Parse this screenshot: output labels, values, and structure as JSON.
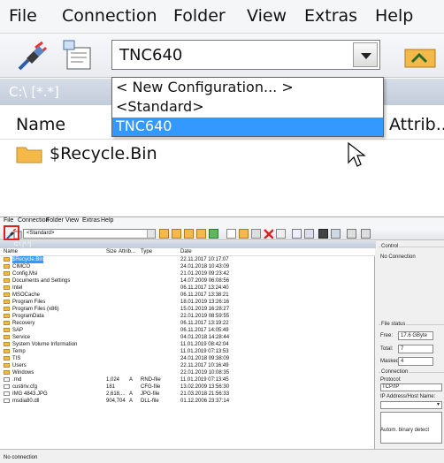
{
  "zoom": {
    "menu": [
      "File",
      "Connection",
      "Folder",
      "View",
      "Extras",
      "Help"
    ],
    "combo_value": "TNC640",
    "path": "C:\\ [*.*]",
    "col_name": "Name",
    "col_attrib": "Attrib...",
    "first_row": "$Recycle.Bin",
    "dropdown_options": [
      "< New Configuration... >",
      "<Standard>",
      "TNC640"
    ],
    "dropdown_selected_index": 2
  },
  "app": {
    "menu": [
      "File",
      "Connection",
      "Folder",
      "View",
      "Extras",
      "Help"
    ],
    "combo_value": "<Standard>",
    "path": "C:\\ [*.*]",
    "columns": [
      "Name",
      "Size",
      "Attrib...",
      "Type",
      "Date"
    ],
    "rows": [
      {
        "name": "$Recycle.Bin",
        "size": "",
        "attr": "",
        "type": "",
        "date": "22.11.2017 10:17:07",
        "kind": "folder",
        "selected": true
      },
      {
        "name": "CIMCO",
        "size": "",
        "attr": "",
        "type": "",
        "date": "24.01.2018 10:43:09",
        "kind": "folder"
      },
      {
        "name": "Config.Msi",
        "size": "",
        "attr": "",
        "type": "",
        "date": "21.01.2019 09:23:42",
        "kind": "folder"
      },
      {
        "name": "Documents and Settings",
        "size": "",
        "attr": "",
        "type": "",
        "date": "14.07.2009 06:08:56",
        "kind": "folder"
      },
      {
        "name": "Intel",
        "size": "",
        "attr": "",
        "type": "",
        "date": "06.11.2017 13:24:40",
        "kind": "folder"
      },
      {
        "name": "MSOCache",
        "size": "",
        "attr": "",
        "type": "",
        "date": "06.11.2017 13:38:21",
        "kind": "folder"
      },
      {
        "name": "Program Files",
        "size": "",
        "attr": "",
        "type": "",
        "date": "18.01.2019 13:26:16",
        "kind": "folder"
      },
      {
        "name": "Program Files (x86)",
        "size": "",
        "attr": "",
        "type": "",
        "date": "15.01.2019 16:28:27",
        "kind": "folder"
      },
      {
        "name": "ProgramData",
        "size": "",
        "attr": "",
        "type": "",
        "date": "22.01.2019 08:59:55",
        "kind": "folder"
      },
      {
        "name": "Recovery",
        "size": "",
        "attr": "",
        "type": "",
        "date": "06.11.2017 13:19:22",
        "kind": "folder"
      },
      {
        "name": "SAP",
        "size": "",
        "attr": "",
        "type": "",
        "date": "06.11.2017 14:05:49",
        "kind": "folder"
      },
      {
        "name": "Service",
        "size": "",
        "attr": "",
        "type": "",
        "date": "04.01.2018 14:28:44",
        "kind": "folder"
      },
      {
        "name": "System Volume Information",
        "size": "",
        "attr": "",
        "type": "",
        "date": "11.01.2019 08:42:04",
        "kind": "folder"
      },
      {
        "name": "Temp",
        "size": "",
        "attr": "",
        "type": "",
        "date": "11.01.2019 07:13:53",
        "kind": "folder"
      },
      {
        "name": "TIS",
        "size": "",
        "attr": "",
        "type": "",
        "date": "24.01.2018 09:38:09",
        "kind": "folder"
      },
      {
        "name": "Users",
        "size": "",
        "attr": "",
        "type": "",
        "date": "22.11.2017 10:16:49",
        "kind": "folder"
      },
      {
        "name": "Windows",
        "size": "",
        "attr": "",
        "type": "",
        "date": "22.01.2019 10:08:35",
        "kind": "folder"
      },
      {
        "name": ".rnd",
        "size": "1,024",
        "attr": "A",
        "type": "RND-file",
        "date": "11.01.2019 07:13:45",
        "kind": "file"
      },
      {
        "name": "custinv.cfg",
        "size": "181",
        "attr": "",
        "type": "CFG-file",
        "date": "13.02.2009 13:56:30",
        "kind": "file"
      },
      {
        "name": "IMG 4843.JPG",
        "size": "2,618,...",
        "attr": "A",
        "type": "JPG-file",
        "date": "21.03.2018 21:56:33",
        "kind": "file"
      },
      {
        "name": "msdia80.dll",
        "size": "904,704",
        "attr": "A",
        "type": "DLL-file",
        "date": "01.12.2006 23:37:14",
        "kind": "file"
      }
    ],
    "side": {
      "control_label": "Control",
      "control_text": "No Connection",
      "file_status_label": "File status",
      "free_label": "Free:",
      "free_value": "17.6 GByte",
      "total_label": "Total:",
      "total_value": "7",
      "masked_label": "Masked:",
      "masked_value": "4",
      "connection_label": "Connection",
      "protocol_label": "Protocol:",
      "protocol_value": "TCP/IP",
      "ip_label": "IP Address/Host Name:",
      "autom_label": "Autom. binary detect"
    },
    "status": "No connection"
  },
  "colors": {
    "accent": "#3399ff",
    "highlight": "#e0201b",
    "folder": "#f5b94a"
  }
}
